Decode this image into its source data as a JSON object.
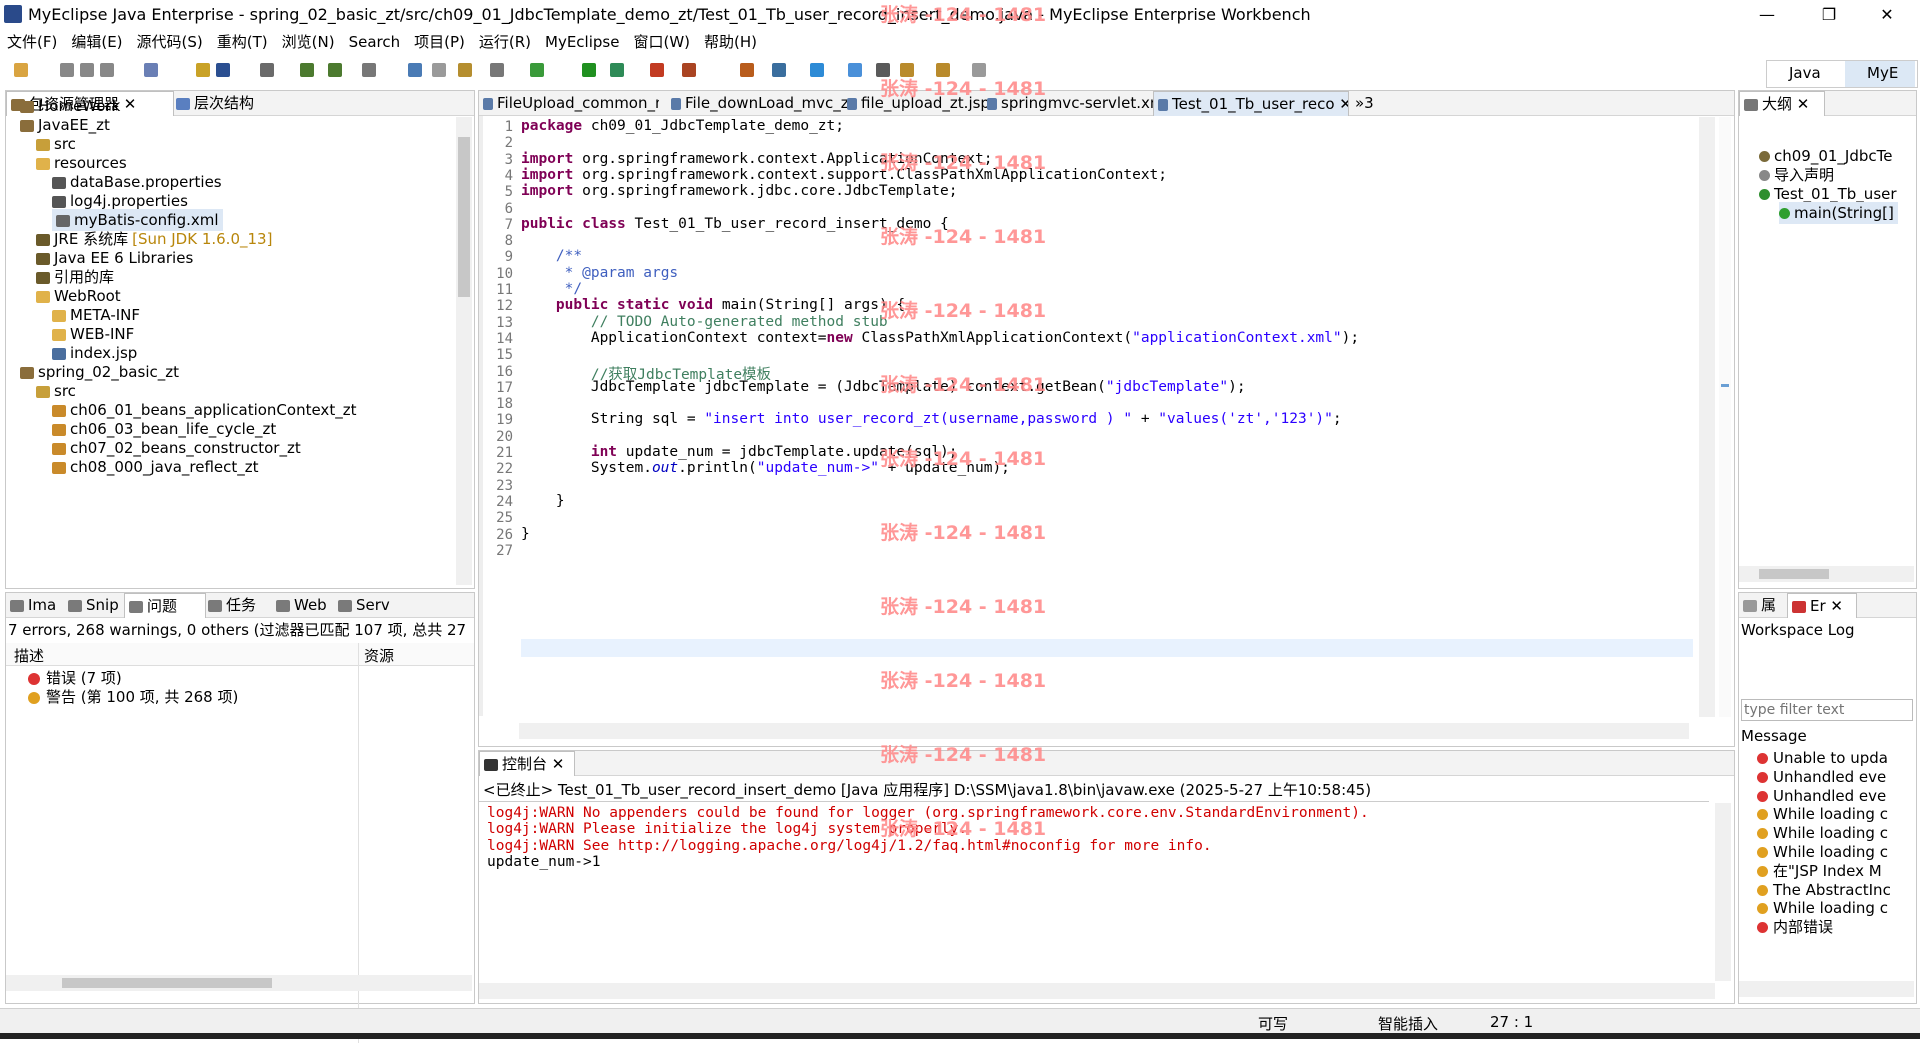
{
  "window": {
    "title": "MyEclipse Java Enterprise  -  spring_02_basic_zt/src/ch09_01_JdbcTemplate_demo_zt/Test_01_Tb_user_record_insert_demo.java  -  MyEclipse Enterprise Workbench",
    "minimize": "—",
    "maximize": "❐",
    "close": "✕"
  },
  "menu": [
    "文件(F)",
    "编辑(E)",
    "源代码(S)",
    "重构(T)",
    "浏览(N)",
    "Search",
    "项目(P)",
    "运行(R)",
    "MyEclipse",
    "窗口(W)",
    "帮助(H)"
  ],
  "perspectives": {
    "java": "Java",
    "myeclipse": "MyE"
  },
  "package_explorer": {
    "tabs": [
      "包资源管理器",
      "层次结构"
    ],
    "items": [
      {
        "label": "HomeWork",
        "indent": 0,
        "icon": "project-icon"
      },
      {
        "label": "JavaEE_zt",
        "indent": 0,
        "icon": "project-icon"
      },
      {
        "label": "src",
        "indent": 1,
        "icon": "source-folder-icon"
      },
      {
        "label": "resources",
        "indent": 1,
        "icon": "folder-icon"
      },
      {
        "label": "dataBase.properties",
        "indent": 2,
        "icon": "properties-file-icon"
      },
      {
        "label": "log4j.properties",
        "indent": 2,
        "icon": "properties-file-icon"
      },
      {
        "label": "myBatis-config.xml",
        "indent": 2,
        "icon": "xml-file-icon",
        "selected": true
      },
      {
        "label": "JRE 系统库",
        "suffix": "[Sun JDK 1.6.0_13]",
        "indent": 1,
        "icon": "library-icon"
      },
      {
        "label": "Java EE 6 Libraries",
        "indent": 1,
        "icon": "library-icon"
      },
      {
        "label": "引用的库",
        "indent": 1,
        "icon": "library-icon"
      },
      {
        "label": "WebRoot",
        "indent": 1,
        "icon": "folder-icon"
      },
      {
        "label": "META-INF",
        "indent": 2,
        "icon": "folder-icon"
      },
      {
        "label": "WEB-INF",
        "indent": 2,
        "icon": "folder-icon"
      },
      {
        "label": "index.jsp",
        "indent": 2,
        "icon": "jsp-file-icon"
      },
      {
        "label": "spring_02_basic_zt",
        "indent": 0,
        "icon": "project-icon"
      },
      {
        "label": "src",
        "indent": 1,
        "icon": "source-folder-icon"
      },
      {
        "label": "ch06_01_beans_applicationContext_zt",
        "indent": 2,
        "icon": "package-icon"
      },
      {
        "label": "ch06_03_bean_life_cycle_zt",
        "indent": 2,
        "icon": "package-icon"
      },
      {
        "label": "ch07_02_beans_constructor_zt",
        "indent": 2,
        "icon": "package-icon"
      },
      {
        "label": "ch08_000_java_reflect_zt",
        "indent": 2,
        "icon": "package-icon"
      }
    ]
  },
  "problems": {
    "tabs": [
      "Ima",
      "Snip",
      "问题",
      "任务",
      "Web",
      "Serv"
    ],
    "summary": "7 errors, 268 warnings, 0 others (过滤器已匹配 107 项, 总共 27",
    "columns": [
      "描述",
      "资源"
    ],
    "rows": [
      {
        "label": "错误 (7 项)",
        "type": "error"
      },
      {
        "label": "警告 (第 100 项, 共 268 项)",
        "type": "warning"
      }
    ]
  },
  "editor": {
    "tabs": [
      "FileUpload_common_mu",
      "File_downLoad_mvc_zt",
      "file_upload_zt.jsp",
      "springmvc-servlet.xm",
      "Test_01_Tb_user_reco"
    ],
    "overflow": "»3",
    "lines": [
      "1",
      "2",
      "3",
      "4",
      "5",
      "6",
      "7",
      "8",
      "9",
      "10",
      "11",
      "12",
      "13",
      "14",
      "15",
      "16",
      "17",
      "18",
      "19",
      "20",
      "21",
      "22",
      "23",
      "24",
      "25",
      "26",
      "27"
    ],
    "code": {
      "l1_kw": "package",
      "l1": " ch09_01_JdbcTemplate_demo_zt;",
      "l3": " org.springframework.context.ApplicationContext;",
      "l4": " org.springframework.context.support.ClassPathXmlApplicationContext;",
      "l5": " org.springframework.jdbc.core.JdbcTemplate;",
      "import": "import",
      "l7_a": "public",
      "l7_b": "class",
      "l7": " Test_01_Tb_user_record_insert_demo {",
      "l9": "    /**",
      "l10_a": "     * ",
      "l10_b": "@param",
      "l10_c": " args",
      "l11": "     */",
      "l12_a": "public",
      "l12_b": "static",
      "l12_c": "void",
      "l12": " main(String[] args) {",
      "l13": "        // TODO Auto-generated method stub",
      "l14_a": "        ApplicationContext context=",
      "l14_kw": "new",
      "l14_b": " ClassPathXmlApplicationContext(",
      "l14_s": "\"applicationContext.xml\"",
      "l14_c": ");",
      "l16": "        //获取JdbcTemplate模板",
      "l17_a": "        JdbcTemplate jdbcTemplate = (JdbcTemplate) context.getBean(",
      "l17_s": "\"jdbcTemplate\"",
      "l17_c": ");",
      "l19_a": "        String sql = ",
      "l19_s1": "\"insert into user_record_zt(username,password ) \"",
      "l19_b": " + ",
      "l19_s2": "\"values('zt','123')\"",
      "l19_c": ";",
      "l21_kw": "int",
      "l21": " update_num = jdbcTemplate.update(sql);",
      "l22_a": "        System.",
      "l22_out": "out",
      "l22_b": ".println(",
      "l22_s": "\"update_num->\"",
      "l22_c": " + update_num);",
      "l24": "    }",
      "l26": "}"
    }
  },
  "outline": {
    "tabs": [
      "大纲"
    ],
    "items": [
      "ch09_01_JdbcTe",
      "导入声明",
      "Test_01_Tb_user",
      "main(String[]"
    ]
  },
  "error_log": {
    "tabs": [
      "属",
      "Er"
    ],
    "title": "Workspace Log",
    "filter_placeholder": "type filter text",
    "column": "Message",
    "rows": [
      {
        "text": "Unable to upda",
        "type": "error"
      },
      {
        "text": "Unhandled eve",
        "type": "error"
      },
      {
        "text": "Unhandled eve",
        "type": "error"
      },
      {
        "text": "While loading c",
        "type": "warning"
      },
      {
        "text": "While loading c",
        "type": "warning"
      },
      {
        "text": "While loading c",
        "type": "warning"
      },
      {
        "text": "在\"JSP Index M",
        "type": "warning"
      },
      {
        "text": "The AbstractInc",
        "type": "warning"
      },
      {
        "text": "While loading c",
        "type": "warning"
      },
      {
        "text": "内部错误",
        "type": "error"
      }
    ]
  },
  "console": {
    "tab": "控制台",
    "header": "<已终止> Test_01_Tb_user_record_insert_demo [Java 应用程序] D:\\SSM\\java1.8\\bin\\javaw.exe  (2025-5-27 上午10:58:45)",
    "lines": [
      {
        "text": "log4j:WARN No appenders could be found for logger (org.springframework.core.env.StandardEnvironment).",
        "warn": true
      },
      {
        "text": "log4j:WARN Please initialize the log4j system properly.",
        "warn": true
      },
      {
        "text": "log4j:WARN See http://logging.apache.org/log4j/1.2/faq.html#noconfig for more info.",
        "warn": true
      },
      {
        "text": "update_num->1",
        "warn": false
      }
    ]
  },
  "status": {
    "writable": "可写",
    "insert_mode": "智能插入",
    "position": "27 : 1"
  },
  "watermark": "张涛 -124 - 1481",
  "colors": {
    "keyword": "#7f0055",
    "string": "#2a00ff",
    "comment": "#3f7f5f",
    "javadoc": "#3f5fbf",
    "console_warn": "#d00000",
    "watermark": "#ff8c8c"
  }
}
